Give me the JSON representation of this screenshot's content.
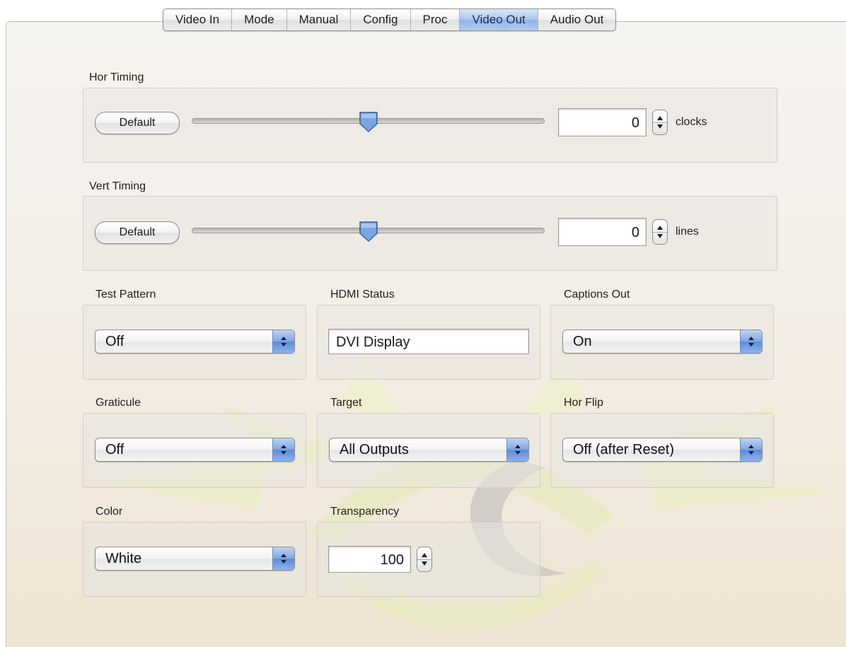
{
  "tabs": [
    {
      "label": "Video In"
    },
    {
      "label": "Mode"
    },
    {
      "label": "Manual"
    },
    {
      "label": "Config"
    },
    {
      "label": "Proc"
    },
    {
      "label": "Video Out",
      "active": true
    },
    {
      "label": "Audio Out"
    }
  ],
  "hor_timing": {
    "title": "Hor Timing",
    "default_label": "Default",
    "slider_fraction": 0.5,
    "value": "0",
    "unit": "clocks"
  },
  "vert_timing": {
    "title": "Vert Timing",
    "default_label": "Default",
    "slider_fraction": 0.5,
    "value": "0",
    "unit": "lines"
  },
  "test_pattern": {
    "title": "Test Pattern",
    "value": "Off"
  },
  "hdmi_status": {
    "title": "HDMI Status",
    "value": "DVI Display"
  },
  "captions_out": {
    "title": "Captions Out",
    "value": "On"
  },
  "graticule": {
    "title": "Graticule",
    "value": "Off"
  },
  "target": {
    "title": "Target",
    "value": "All Outputs"
  },
  "hor_flip": {
    "title": "Hor Flip",
    "value": "Off (after Reset)"
  },
  "color": {
    "title": "Color",
    "value": "White"
  },
  "transparency": {
    "title": "Transparency",
    "value": "100"
  },
  "colors": {
    "active_tab": "#9dbce9",
    "select_arrow_accent": "#6f9be0",
    "watermark_yellow": "#e9edc2",
    "watermark_gray": "#cfcac4"
  }
}
